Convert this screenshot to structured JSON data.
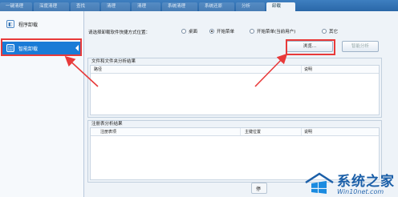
{
  "toolbar": {
    "tabs": [
      {
        "label": "一键清理"
      },
      {
        "label": "深度清理"
      },
      {
        "label": "查找"
      },
      {
        "label": "清理"
      },
      {
        "label": "清理"
      },
      {
        "label": "系统清理"
      },
      {
        "label": "系统还原"
      },
      {
        "label": "分析"
      },
      {
        "label": "卸载"
      }
    ]
  },
  "sidebar": {
    "items": [
      {
        "label": "程序卸载",
        "icon": "app-uninstall-icon"
      },
      {
        "label": "智能卸载",
        "icon": "smart-uninstall-icon"
      }
    ]
  },
  "location": {
    "label": "请选择卸载软件快捷方式位置：",
    "options": [
      {
        "label": "桌面",
        "selected": false
      },
      {
        "label": "开始菜单",
        "selected": true
      },
      {
        "label": "开始菜单(当前用户)",
        "selected": false
      },
      {
        "label": "其它",
        "selected": false
      }
    ]
  },
  "buttons": {
    "browse": "浏览...",
    "smart_analyze": "智能分析"
  },
  "files_group": {
    "title": "文件和文件夹分析结果",
    "columns": [
      "路径",
      "说明"
    ]
  },
  "registry_group": {
    "title": "注册表分析结果",
    "columns": [
      "注册表项",
      "主键位置",
      "说明"
    ]
  },
  "bottom": {
    "partial_label": "停"
  },
  "watermark": {
    "name": "系统之家",
    "url": "Win10net.com"
  },
  "colors": {
    "highlight": "#e83a3a",
    "selected_item": "#1a7bd6",
    "brand": "#1b5fa8"
  }
}
